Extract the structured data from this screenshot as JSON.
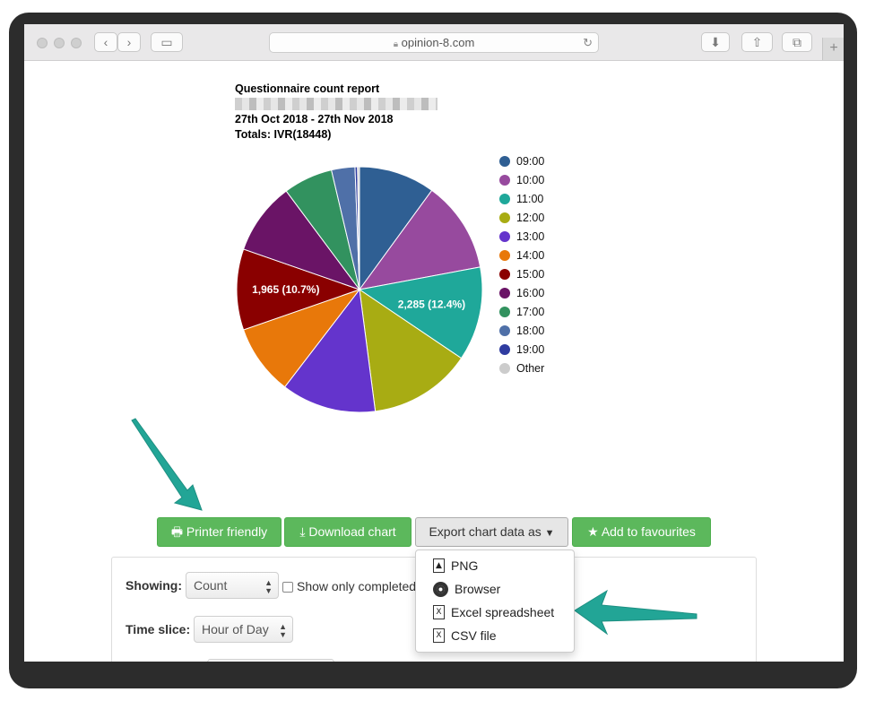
{
  "browser": {
    "url": "opinion-8.com"
  },
  "report": {
    "title": "Questionnaire count report",
    "date_range": "27th Oct 2018 - 27th Nov 2018",
    "totals": "Totals: IVR(18448)"
  },
  "chart_data": {
    "type": "pie",
    "categories": [
      "09:00",
      "10:00",
      "11:00",
      "12:00",
      "13:00",
      "14:00",
      "15:00",
      "16:00",
      "17:00",
      "18:00",
      "19:00",
      "Other"
    ],
    "values": [
      1850,
      2220,
      2285,
      2490,
      2300,
      1710,
      1965,
      1750,
      1200,
      570,
      60,
      48
    ],
    "colors": [
      "#2f5f93",
      "#974a9e",
      "#1fa89a",
      "#a8ac13",
      "#6434cc",
      "#e8780a",
      "#8a0000",
      "#6a1466",
      "#32925f",
      "#4f70a8",
      "#2f3ca0",
      "#cccccc"
    ],
    "slice_labels": [
      {
        "category": "11:00",
        "text": "2,285 (12.4%)"
      },
      {
        "category": "15:00",
        "text": "1,965 (10.7%)"
      }
    ],
    "legend_position": "right"
  },
  "buttons": {
    "printer": "Printer friendly",
    "download": "Download chart",
    "export": "Export chart data as",
    "favourites": "Add to favourites"
  },
  "export_menu": [
    "PNG",
    "Browser",
    "Excel spreadsheet",
    "CSV file"
  ],
  "options": {
    "showing_label": "Showing:",
    "showing_value": "Count",
    "completed_label": "Show only completed",
    "time_slice_label": "Time slice:",
    "time_slice_value": "Hour of Day"
  },
  "colors": {
    "green_button": "#5cb85c",
    "annotation_arrow": "#22a596"
  }
}
